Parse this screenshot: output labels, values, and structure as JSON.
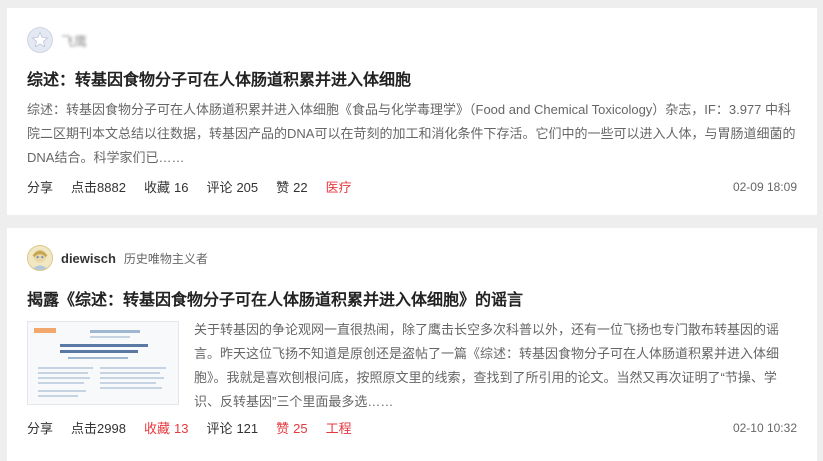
{
  "posts": [
    {
      "author": {
        "name": "飞鹰",
        "tagline": ""
      },
      "title": "综述：转基因食物分子可在人体肠道积累并进入体细胞",
      "summary": "综述：转基因食物分子可在人体肠道积累并进入体细胞《食品与化学毒理学》（Food and Chemical Toxicology）杂志，IF：3.977  中科院二区期刊本文总结以往数据，转基因产品的DNA可以在苛刻的加工和消化条件下存活。它们中的一些可以进入人体，与胃肠道细菌的DNA结合。科学家们已……",
      "share_label": "分享",
      "clicks_label": "点击",
      "clicks": "8882",
      "favorites_label": "收藏",
      "favorites": "16",
      "comments_label": "评论",
      "comments": "205",
      "likes_label": "赞",
      "likes": "22",
      "category": "医疗",
      "date": "02-09 18:09",
      "avatar_icon": "default-star-avatar"
    },
    {
      "author": {
        "name": "diewisch",
        "tagline": "历史唯物主义者"
      },
      "title": "揭露《综述：转基因食物分子可在人体肠道积累并进入体细胞》的谣言",
      "summary": "关于转基因的争论观网一直很热闹，除了鹰击长空多次科普以外，还有一位飞扬也专门散布转基因的谣言。昨天这位飞扬不知道是原创还是盗帖了一篇《综述：转基因食物分子可在人体肠道积累并进入体细胞》。我就是喜欢刨根问底，按照原文里的线索，查找到了所引用的论文。当然又再次证明了“节操、学识、反转基因”三个里面最多选……",
      "share_label": "分享",
      "clicks_label": "点击",
      "clicks": "2998",
      "favorites_label": "收藏",
      "favorites": "13",
      "comments_label": "评论",
      "comments": "121",
      "likes_label": "赞",
      "likes": "25",
      "category": "工程",
      "date": "02-10 10:32",
      "avatar_icon": "user-avatar"
    }
  ],
  "colors": {
    "accent": "#e5393f",
    "background": "#eeeeee",
    "card": "#ffffff"
  }
}
